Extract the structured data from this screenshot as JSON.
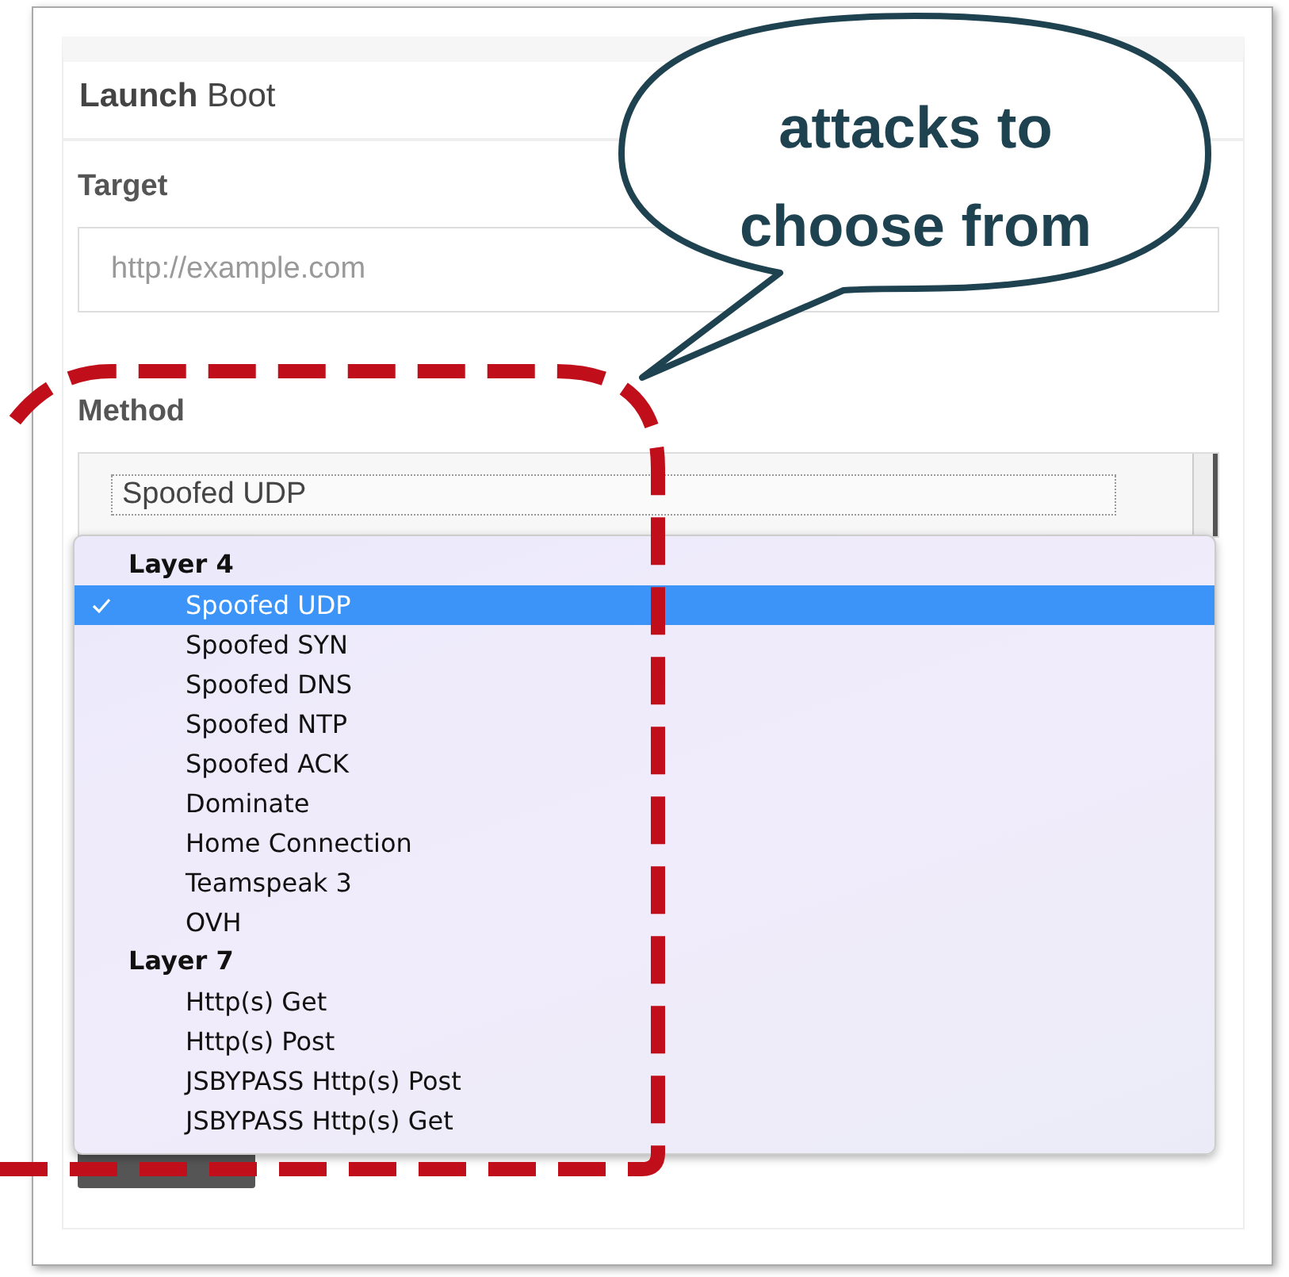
{
  "panel": {
    "title": "**Launch** Boot",
    "target": {
      "label": "Target",
      "placeholder": "http://example.com"
    },
    "method": {
      "label": "Method",
      "value": "Spoofed UDP"
    }
  },
  "dropdown": {
    "groups": [
      {
        "label": "Layer 4",
        "options": [
          {
            "label": "Spoofed UDP",
            "selected": true
          },
          {
            "label": "Spoofed SYN",
            "selected": false
          },
          {
            "label": "Spoofed DNS",
            "selected": false
          },
          {
            "label": "Spoofed NTP",
            "selected": false
          },
          {
            "label": "Spoofed ACK",
            "selected": false
          },
          {
            "label": "Dominate",
            "selected": false
          },
          {
            "label": "Home Connection",
            "selected": false
          },
          {
            "label": "Teamspeak 3",
            "selected": false
          },
          {
            "label": "OVH",
            "selected": false
          }
        ]
      },
      {
        "label": "Layer 7",
        "options": [
          {
            "label": "Http(s) Get",
            "selected": false
          },
          {
            "label": "Http(s) Post",
            "selected": false
          },
          {
            "label": "JSBYPASS Http(s) Post",
            "selected": false
          },
          {
            "label": "JSBYPASS Http(s) Get",
            "selected": false
          }
        ]
      }
    ]
  },
  "callout": {
    "text": "attacks to choose from"
  }
}
